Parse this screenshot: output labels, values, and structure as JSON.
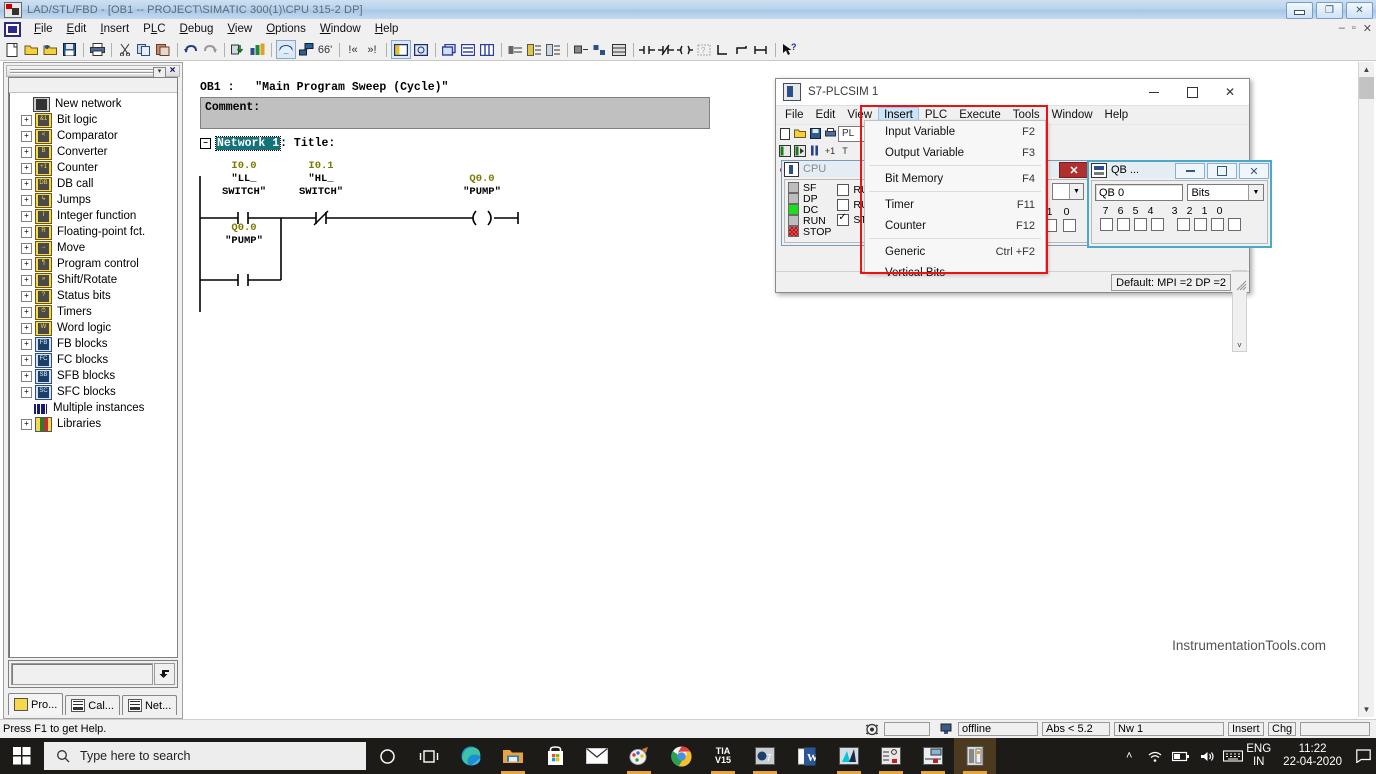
{
  "main_window": {
    "title": "LAD/STL/FBD  - [OB1 -- PROJECT\\SIMATIC 300(1)\\CPU 315-2 DP]",
    "window_buttons": {
      "minimize": "minimize-icon",
      "restore": "restore-icon",
      "close": "close-icon"
    },
    "mdi_buttons": {
      "minimize": "–",
      "restore": "▫",
      "close": "✕"
    },
    "menu": [
      "File",
      "Edit",
      "Insert",
      "PLC",
      "Debug",
      "View",
      "Options",
      "Window",
      "Help"
    ]
  },
  "left_panel": {
    "close_label": "×",
    "tree": [
      {
        "label": "New network",
        "expandable": false,
        "icon": "network-icon"
      },
      {
        "label": "Bit logic",
        "expandable": true,
        "icon": "bitlogic-icon",
        "glyph": "&1"
      },
      {
        "label": "Comparator",
        "expandable": true,
        "icon": "comparator-icon",
        "glyph": "<"
      },
      {
        "label": "Converter",
        "expandable": true,
        "icon": "converter-icon",
        "glyph": "B"
      },
      {
        "label": "Counter",
        "expandable": true,
        "icon": "counter-icon",
        "glyph": "+1"
      },
      {
        "label": "DB call",
        "expandable": true,
        "icon": "dbcall-icon",
        "glyph": "DB"
      },
      {
        "label": "Jumps",
        "expandable": true,
        "icon": "jumps-icon",
        "glyph": "↳"
      },
      {
        "label": "Integer function",
        "expandable": true,
        "icon": "integer-icon",
        "glyph": "I"
      },
      {
        "label": "Floating-point fct.",
        "expandable": true,
        "icon": "float-icon",
        "glyph": "R"
      },
      {
        "label": "Move",
        "expandable": true,
        "icon": "move-icon",
        "glyph": "→"
      },
      {
        "label": "Program control",
        "expandable": true,
        "icon": "progctrl-icon",
        "glyph": "¶"
      },
      {
        "label": "Shift/Rotate",
        "expandable": true,
        "icon": "shift-icon",
        "glyph": "»"
      },
      {
        "label": "Status bits",
        "expandable": true,
        "icon": "statusbits-icon",
        "glyph": "?"
      },
      {
        "label": "Timers",
        "expandable": true,
        "icon": "timers-icon",
        "glyph": "⏱"
      },
      {
        "label": "Word logic",
        "expandable": true,
        "icon": "wordlogic-icon",
        "glyph": "W"
      },
      {
        "label": "FB blocks",
        "expandable": true,
        "icon": "fb-icon",
        "glyph": "FB"
      },
      {
        "label": "FC blocks",
        "expandable": true,
        "icon": "fc-icon",
        "glyph": "FC"
      },
      {
        "label": "SFB blocks",
        "expandable": true,
        "icon": "sfb-icon",
        "glyph": "SB"
      },
      {
        "label": "SFC blocks",
        "expandable": true,
        "icon": "sfc-icon",
        "glyph": "SC"
      },
      {
        "label": "Multiple instances",
        "expandable": false,
        "icon": "multi-instance-icon"
      },
      {
        "label": "Libraries",
        "expandable": true,
        "icon": "libraries-icon"
      }
    ],
    "tabs": [
      {
        "label": "Pro...",
        "selected": true
      },
      {
        "label": "Cal...",
        "selected": false
      },
      {
        "label": "Net...",
        "selected": false
      }
    ]
  },
  "editor": {
    "block_title": "OB1 :   \"Main Program Sweep (Cycle)\"",
    "comment_label": "Comment:",
    "network_name": "Network 1",
    "network_title_suffix": ": Title:",
    "ladder": {
      "rung1": [
        {
          "addr": "I0.0",
          "sym_line1": "\"LL_",
          "sym_line2": "SWITCH\"",
          "type": "NO-contact"
        },
        {
          "addr": "I0.1",
          "sym_line1": "\"HL_",
          "sym_line2": "SWITCH\"",
          "type": "NC-contact"
        },
        {
          "addr": "Q0.0",
          "sym_line1": "\"PUMP\"",
          "sym_line2": "",
          "type": "coil"
        }
      ],
      "rung2": [
        {
          "addr": "Q0.0",
          "sym_line1": "\"PUMP\"",
          "sym_line2": "",
          "type": "NO-contact"
        }
      ]
    },
    "watermark": "InstrumentationTools.com"
  },
  "status_bar": {
    "help_text": "Press F1 to get Help.",
    "connection": "offline",
    "abs": "Abs < 5.2",
    "network": "Nw 1",
    "insert_mode": "Insert",
    "chg": "Chg"
  },
  "plcsim": {
    "title": "S7-PLCSIM 1",
    "menu": [
      "File",
      "Edit",
      "View",
      "Insert",
      "PLC",
      "Execute",
      "Tools",
      "Window",
      "Help"
    ],
    "selected_menu": "Insert",
    "insert_menu": [
      {
        "label": "Input Variable",
        "key": "F2",
        "sep_after": false
      },
      {
        "label": "Output Variable",
        "key": "F3",
        "sep_after": true
      },
      {
        "label": "Bit Memory",
        "key": "F4",
        "sep_after": true
      },
      {
        "label": "Timer",
        "key": "F11",
        "sep_after": false
      },
      {
        "label": "Counter",
        "key": "F12",
        "sep_after": true
      },
      {
        "label": "Generic",
        "key": "Ctrl +F2",
        "sep_after": false
      },
      {
        "label": "Vertical Bits",
        "key": "",
        "sep_after": false
      }
    ],
    "cpu_window": {
      "title": "CPU",
      "leds": [
        {
          "label": "SF",
          "state": "off"
        },
        {
          "label": "DP",
          "state": "off"
        },
        {
          "label": "DC",
          "state": "green"
        },
        {
          "label": "RUN",
          "state": "off"
        },
        {
          "label": "STOP",
          "state": "red"
        }
      ],
      "modes": [
        {
          "label": "RU",
          "checked": false
        },
        {
          "label": "RU",
          "checked": false
        },
        {
          "label": "ST",
          "checked": true
        }
      ]
    },
    "qb_window": {
      "title": "QB ...",
      "address": "QB   0",
      "format": "Bits",
      "bit_labels_high": [
        "7",
        "6",
        "5",
        "4"
      ],
      "bit_labels_low": [
        "3",
        "2",
        "1",
        "0"
      ],
      "bits": [
        false,
        false,
        false,
        false,
        false,
        false,
        false,
        false
      ]
    },
    "hidden_window": {
      "bit_labels": [
        "1",
        "0"
      ]
    },
    "status": "Default:  MPI =2 DP =2"
  },
  "taskbar": {
    "search_placeholder": "Type here to search",
    "items": [
      {
        "name": "cortana-icon",
        "active": false,
        "underline": false
      },
      {
        "name": "task-view-icon",
        "active": false,
        "underline": false
      },
      {
        "name": "edge-icon",
        "active": false,
        "underline": false
      },
      {
        "name": "file-explorer-icon",
        "active": false,
        "underline": true
      },
      {
        "name": "microsoft-store-icon",
        "active": false,
        "underline": false
      },
      {
        "name": "mail-icon",
        "active": false,
        "underline": false
      },
      {
        "name": "paint-icon",
        "active": false,
        "underline": true
      },
      {
        "name": "chrome-icon",
        "active": false,
        "underline": false
      },
      {
        "name": "tia-portal-v15-icon",
        "active": false,
        "underline": true,
        "label": "TIA",
        "label2": "V15"
      },
      {
        "name": "step7-icon",
        "active": false,
        "underline": true
      },
      {
        "name": "word-icon",
        "active": false,
        "underline": false
      },
      {
        "name": "simatic-manager-icon",
        "active": false,
        "underline": true
      },
      {
        "name": "lad-stl-fbd-icon",
        "active": false,
        "underline": true
      },
      {
        "name": "netpro-icon",
        "active": false,
        "underline": true
      },
      {
        "name": "plcsim-icon",
        "active": true,
        "underline": true
      }
    ],
    "tray": {
      "language_line1": "ENG",
      "language_line2": "IN",
      "time": "11:22",
      "date": "22-04-2020"
    }
  },
  "colors": {
    "accent_blue": "#cce4f7",
    "highlight_teal": "#14727a",
    "red_box": "#ee1111",
    "led_green": "#19e019",
    "led_red": "#e04a4a",
    "ladder_label": "#7a7a00",
    "taskbar_bg": "#1d1b17"
  }
}
